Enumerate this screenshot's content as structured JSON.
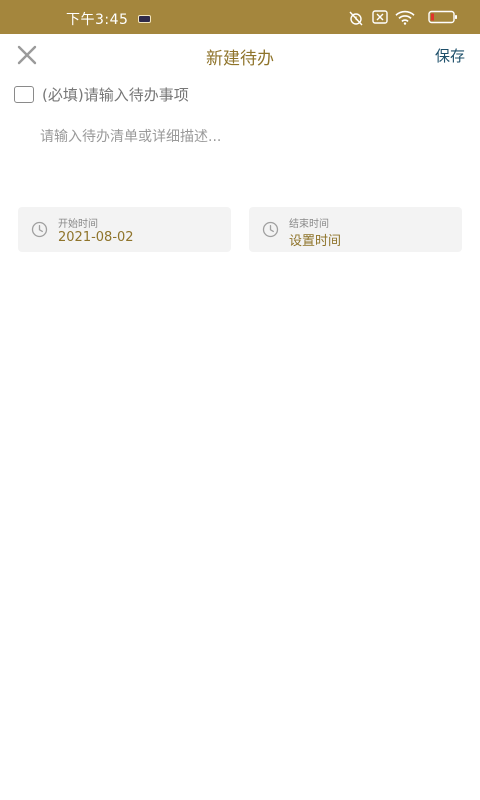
{
  "status_bar": {
    "time": "下午3:45",
    "battery_level": "9"
  },
  "header": {
    "title": "新建待办",
    "save_label": "保存"
  },
  "form": {
    "title_placeholder": "(必填)请输入待办事项",
    "title_value": "",
    "description_placeholder": "请输入待办清单或详细描述...",
    "description_value": "",
    "start": {
      "label": "开始时间",
      "value": "2021-08-02"
    },
    "end": {
      "label": "结束时间",
      "value": "设置时间"
    }
  },
  "colors": {
    "status_bar_bg": "#a4863d",
    "accent_gold": "#8f742b",
    "save_blue": "#1d4f6a",
    "card_bg": "#f3f3f3"
  }
}
